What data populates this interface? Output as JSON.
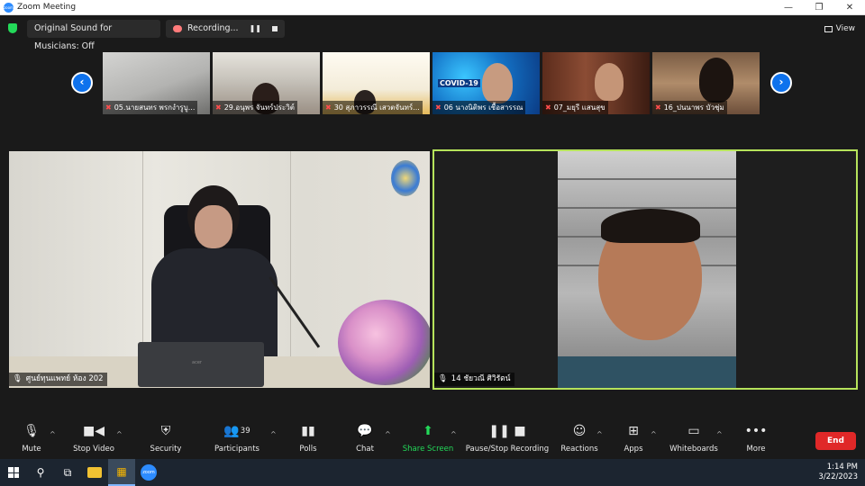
{
  "window": {
    "title": "Zoom Meeting",
    "controls": [
      "—",
      "❐",
      "✕"
    ]
  },
  "topbar": {
    "audio_label": "Original Sound for Musicians: Off",
    "recording_label": "Recording...",
    "view_label": "View"
  },
  "gallery": {
    "prev_arrow": "‹",
    "next_arrow": "›",
    "thumbnails": [
      {
        "name": "05.นายสนทร พรกงำรูบู..."
      },
      {
        "name": "29.อนุพร จันทร์ประวิต์"
      },
      {
        "name": "30 สุภาวรรณี เสวตจันทร์..."
      },
      {
        "name": "06 นางนิติพร เชื้อสารรณ"
      },
      {
        "name": "07_มยุรี แสนสุข"
      },
      {
        "name": "16_ปนนาพร บัวชุ่ม"
      }
    ],
    "covid_label": "COVID-19"
  },
  "main": {
    "left_tile": {
      "name": "ศูนย์ทุนแพทย์ ห้อง 202",
      "laptop_brand": "acer"
    },
    "right_tile": {
      "name": "14 ชัยวณี ศิวิรัตน์"
    }
  },
  "toolbar": {
    "mute": "Mute",
    "stop_video": "Stop Video",
    "security": "Security",
    "participants": "Participants",
    "participants_count": "39",
    "polls": "Polls",
    "chat": "Chat",
    "share_screen": "Share Screen",
    "pause_stop_recording": "Pause/Stop Recording",
    "reactions": "Reactions",
    "apps": "Apps",
    "whiteboards": "Whiteboards",
    "more": "More",
    "end": "End"
  },
  "taskbar": {
    "time": "1:14 PM",
    "date": "3/22/2023"
  },
  "colors": {
    "zoom_blue": "#0e72ed",
    "active_speaker_border": "#b6e35b",
    "share_green": "#23d959",
    "end_red": "#e02828"
  }
}
